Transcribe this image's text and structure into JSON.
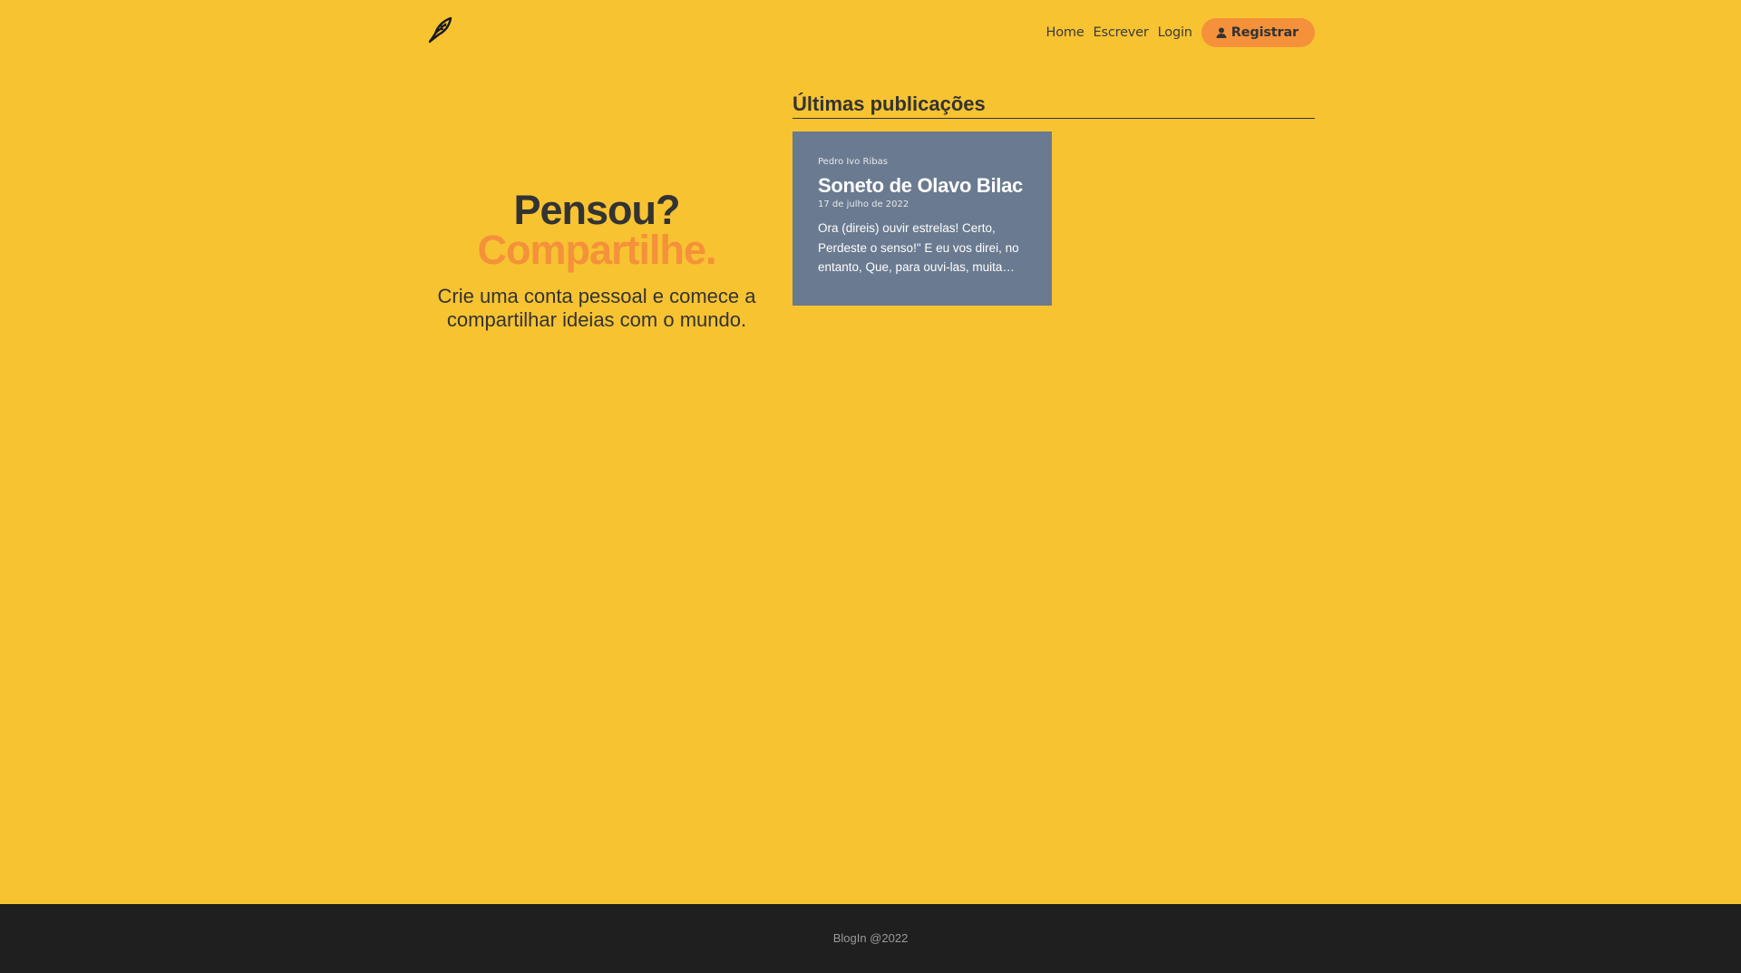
{
  "nav": {
    "logo_icon": "quill-feather-icon",
    "links": [
      "Home",
      "Escrever",
      "Login"
    ],
    "register_label": "Registrar"
  },
  "hero": {
    "line1": "Pensou?",
    "line2": "Compartilhe.",
    "subtitle": "Crie uma conta pessoal e comece a compartilhar ideias com o mundo."
  },
  "latest": {
    "title": "Últimas publicações",
    "posts": [
      {
        "author": "Pedro Ivo Ribas",
        "title": "Soneto de Olavo Bilac",
        "date": "17 de julho de 2022",
        "excerpt": "Ora (direis) ouvir estrelas! Certo, Perdeste o senso!\" E eu vos direi, no entanto, Que, para ouvi-las, muita…"
      }
    ]
  },
  "footer": {
    "text": "BlogIn @2022"
  },
  "colors": {
    "background": "#f7c331",
    "accent": "#f5913a",
    "card": "#6a7a90",
    "footer": "#1f1f1f"
  }
}
